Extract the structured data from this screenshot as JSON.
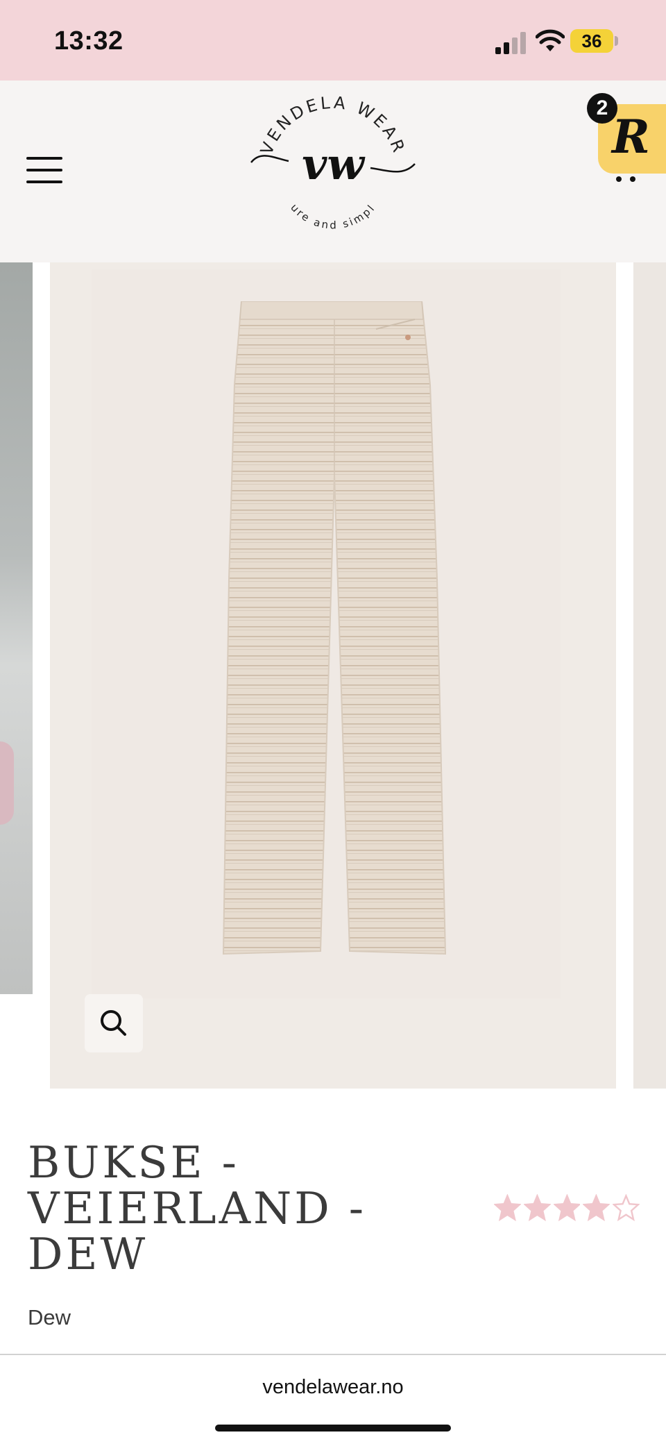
{
  "status_bar": {
    "time": "13:32",
    "battery_level": "36",
    "background": "#f3d5d9"
  },
  "header": {
    "brand_top": "VENDELA WEAR",
    "brand_mark": "vw",
    "brand_tagline": "pure and simple",
    "rewards_badge_count": "2",
    "rewards_letter": "R",
    "icons": [
      "hamburger-menu-icon",
      "cart-icon"
    ]
  },
  "gallery": {
    "zoom_icon": "search-icon"
  },
  "product": {
    "title": "BUKSE - VEIERLAND - DEW",
    "variant": "Dew",
    "rating": 4,
    "rating_max": 5,
    "star_color": "#f0c6cc"
  },
  "browser": {
    "url": "vendelawear.no"
  }
}
